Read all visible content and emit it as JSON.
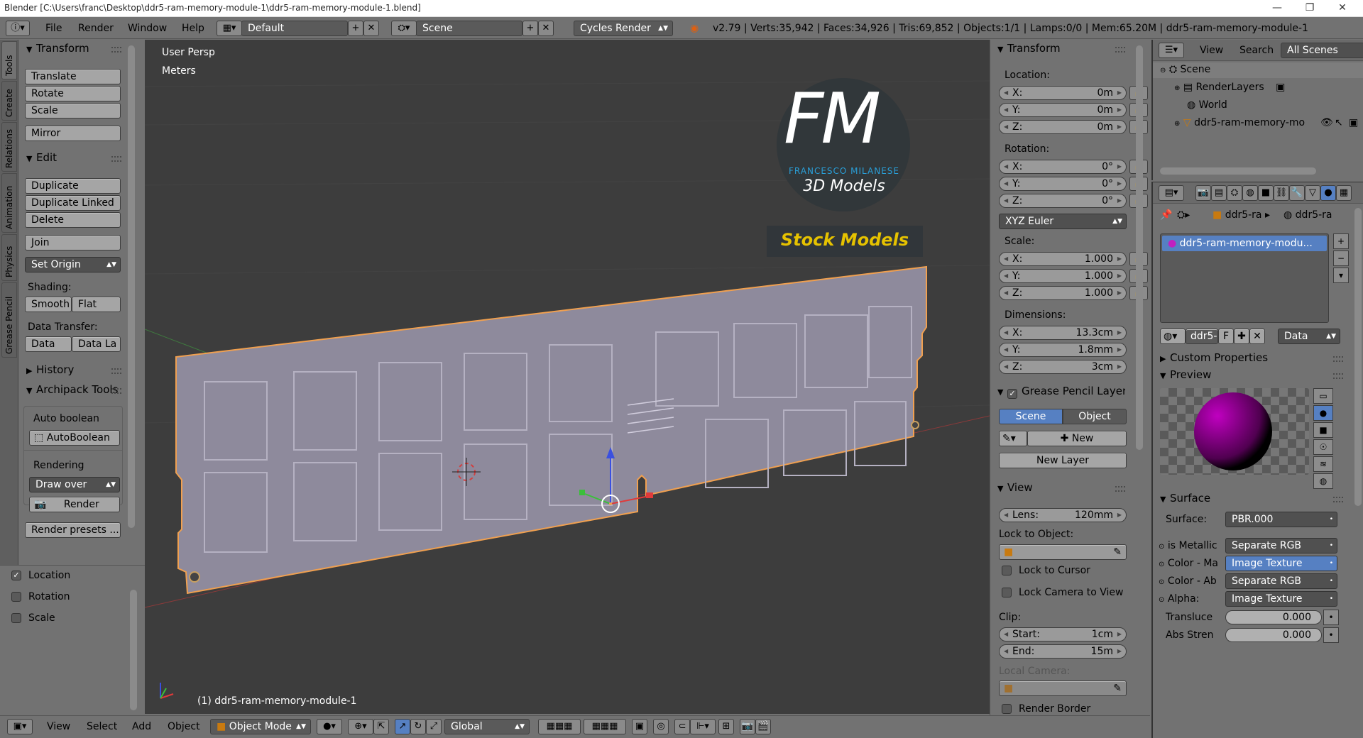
{
  "window": {
    "title": "Blender [C:\\Users\\franc\\Desktop\\ddr5-ram-memory-module-1\\ddr5-ram-memory-module-1.blend]",
    "minimize": "—",
    "maximize": "❐",
    "close": "✕"
  },
  "info_header": {
    "menus": [
      "File",
      "Render",
      "Window",
      "Help"
    ],
    "layout": "Default",
    "scene": "Scene",
    "engine": "Cycles Render",
    "stats": "v2.79 | Verts:35,942 | Faces:34,926 | Tris:69,852 | Objects:1/1 | Lamps:0/0 | Mem:65.20M | ddr5-ram-memory-module-1"
  },
  "left_tabs": [
    "Tools",
    "Create",
    "Relations",
    "Animation",
    "Physics",
    "Grease Pencil"
  ],
  "tool_shelf": {
    "transform": {
      "title": "Transform",
      "buttons": [
        "Translate",
        "Rotate",
        "Scale",
        "Mirror"
      ]
    },
    "edit": {
      "title": "Edit",
      "buttons": [
        "Duplicate",
        "Duplicate Linked",
        "Delete",
        "Join"
      ],
      "set_origin": "Set Origin",
      "shading_label": "Shading:",
      "smooth": "Smooth",
      "flat": "Flat",
      "data_transfer_label": "Data Transfer:",
      "data": "Data",
      "data_la": "Data La"
    },
    "history": {
      "title": "History"
    },
    "archipack": {
      "title": "Archipack Tools",
      "auto_boolean_label": "Auto boolean",
      "auto_boolean_btn": "AutoBoolean",
      "rendering_label": "Rendering",
      "draw_over": "Draw over",
      "render": "Render",
      "render_presets": "Render presets ..."
    },
    "options": [
      "Location",
      "Rotation",
      "Scale"
    ]
  },
  "viewport": {
    "view_name": "User Persp",
    "units": "Meters",
    "object_label": "(1) ddr5-ram-memory-module-1",
    "logo": {
      "letters": "FM",
      "brand": "FRANCESCO MILANESE",
      "line": "3D Models",
      "banner": "Stock Models"
    }
  },
  "n_panel": {
    "transform": {
      "title": "Transform",
      "location_label": "Location:",
      "location": [
        {
          "axis": "X:",
          "value": "0m"
        },
        {
          "axis": "Y:",
          "value": "0m"
        },
        {
          "axis": "Z:",
          "value": "0m"
        }
      ],
      "rotation_label": "Rotation:",
      "rotation": [
        {
          "axis": "X:",
          "value": "0°"
        },
        {
          "axis": "Y:",
          "value": "0°"
        },
        {
          "axis": "Z:",
          "value": "0°"
        }
      ],
      "rotation_mode": "XYZ Euler",
      "scale_label": "Scale:",
      "scale": [
        {
          "axis": "X:",
          "value": "1.000"
        },
        {
          "axis": "Y:",
          "value": "1.000"
        },
        {
          "axis": "Z:",
          "value": "1.000"
        }
      ],
      "dimensions_label": "Dimensions:",
      "dimensions": [
        {
          "axis": "X:",
          "value": "13.3cm"
        },
        {
          "axis": "Y:",
          "value": "1.8mm"
        },
        {
          "axis": "Z:",
          "value": "3cm"
        }
      ]
    },
    "grease_pencil": {
      "title": "Grease Pencil Layer",
      "scene": "Scene",
      "object": "Object",
      "new": "New",
      "new_layer": "New Layer"
    },
    "view": {
      "title": "View",
      "lens_label": "Lens:",
      "lens": "120mm",
      "lock_to_object": "Lock to Object:",
      "lock_to_cursor": "Lock to Cursor",
      "lock_camera": "Lock Camera to View",
      "clip_label": "Clip:",
      "start_label": "Start:",
      "start": "1cm",
      "end_label": "End:",
      "end": "15m",
      "local_camera": "Local Camera:",
      "render_border": "Render Border"
    }
  },
  "outliner": {
    "view": "View",
    "search": "Search",
    "filter": "All Scenes",
    "items": [
      "Scene",
      "RenderLayers",
      "World",
      "ddr5-ram-memory-mo"
    ]
  },
  "properties": {
    "breadcrumb": [
      "ddr5-ra",
      "ddr5-ra"
    ],
    "material_slot": "ddr5-ram-memory-modu...",
    "mat_name": "ddr5-",
    "fake_user": "F",
    "link": "Data",
    "custom_props": "Custom Properties",
    "preview": "Preview",
    "surface_title": "Surface",
    "surface_label": "Surface:",
    "surface_value": "PBR.000",
    "inputs": [
      {
        "label": "is Metallic",
        "value": "Separate RGB"
      },
      {
        "label": "Color - Ma",
        "value": "Image Texture"
      },
      {
        "label": "Color - Ab",
        "value": "Separate RGB"
      },
      {
        "label": "Alpha:",
        "value": "Image Texture"
      }
    ],
    "translucent_label": "Transluce",
    "translucent": "0.000",
    "abs_label": "Abs Stren",
    "abs": "0.000"
  },
  "bottom_bar": {
    "menus": [
      "View",
      "Select",
      "Add",
      "Object"
    ],
    "mode": "Object Mode",
    "orientation": "Global"
  },
  "colors": {
    "accent": "#5680c2",
    "viewport_bg": "#3d3d3d",
    "panel_bg": "#727272",
    "selected_outline": "#f0a050",
    "logo_blue": "#2a9fd8",
    "banner_yellow": "#e6c200"
  }
}
